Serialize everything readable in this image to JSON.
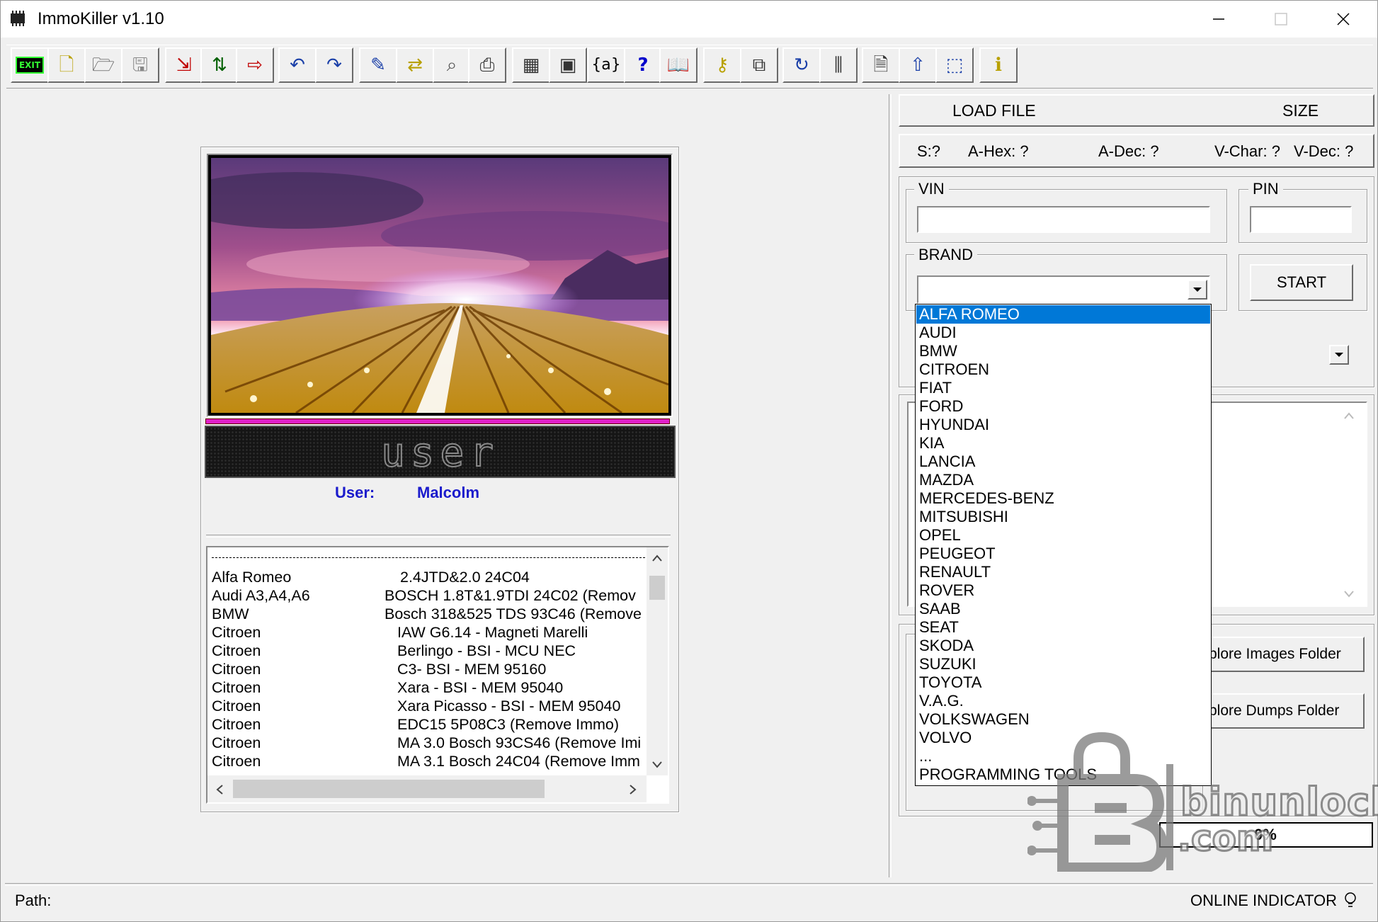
{
  "window": {
    "title": "ImmoKiller v1.10"
  },
  "toolbar": {
    "buttons": [
      {
        "name": "exit-button",
        "glyph": "EXIT",
        "color": "#008000"
      },
      {
        "name": "new-file-button",
        "glyph": "🗋",
        "color": "#b8a000"
      },
      {
        "name": "open-file-button",
        "glyph": "🗁",
        "color": "#444444"
      },
      {
        "name": "save-button",
        "glyph": "🖫",
        "color": "#888888"
      },
      {
        "name": "import-button",
        "glyph": "⇲",
        "color": "#c00000"
      },
      {
        "name": "swap-bytes-button",
        "glyph": "⇅",
        "color": "#006000"
      },
      {
        "name": "export-button",
        "glyph": "⇨",
        "color": "#c00000"
      },
      {
        "name": "undo-button",
        "glyph": "↶",
        "color": "#1a3fa8"
      },
      {
        "name": "redo-button",
        "glyph": "↷",
        "color": "#1a3fa8"
      },
      {
        "name": "edit-button",
        "glyph": "✎",
        "color": "#1a3fa8"
      },
      {
        "name": "convert-button",
        "glyph": "⇄",
        "color": "#b8a000"
      },
      {
        "name": "find-button",
        "glyph": "⌕",
        "color": "#555555"
      },
      {
        "name": "print-button",
        "glyph": "⎙",
        "color": "#333333"
      },
      {
        "name": "calculator-button",
        "glyph": "▦",
        "color": "#333333"
      },
      {
        "name": "chip-button",
        "glyph": "▣",
        "color": "#333333"
      },
      {
        "name": "variables-button",
        "glyph": "{a}",
        "color": "#000000"
      },
      {
        "name": "help-button",
        "glyph": "?",
        "color": "#0000cc"
      },
      {
        "name": "manual-button",
        "glyph": "📖",
        "color": "#444444"
      },
      {
        "name": "key-button",
        "glyph": "⚷",
        "color": "#b8a000"
      },
      {
        "name": "copy-windows-button",
        "glyph": "⧉",
        "color": "#333333"
      },
      {
        "name": "refresh-button",
        "glyph": "↻",
        "color": "#1a3fa8"
      },
      {
        "name": "columns-button",
        "glyph": "⫼",
        "color": "#333333"
      },
      {
        "name": "new-doc-button",
        "glyph": "🗎",
        "color": "#333333"
      },
      {
        "name": "upload-button",
        "glyph": "⇧",
        "color": "#1a3fa8"
      },
      {
        "name": "select-area-button",
        "glyph": "⬚",
        "color": "#1a3fa8"
      },
      {
        "name": "info-button",
        "glyph": "ℹ",
        "color": "#b8a000"
      }
    ]
  },
  "left": {
    "banner_text": "user",
    "user_label": "User:",
    "user_name": "Malcolm",
    "list_rows": [
      {
        "brand": "Alfa Romeo",
        "module": "2.4JTD&2.0     24C04"
      },
      {
        "brand": "Audi A3,A4,A6",
        "module": "BOSCH 1.8T&1.9TDI    24C02 (Remov"
      },
      {
        "brand": "BMW",
        "module": "Bosch 318&525 TDS 93C46 (Remove"
      },
      {
        "brand": "Citroen",
        "module": "IAW G6.14 - Magneti Marelli"
      },
      {
        "brand": "Citroen",
        "module": "Berlingo - BSI - MCU NEC"
      },
      {
        "brand": "Citroen",
        "module": "C3- BSI - MEM 95160"
      },
      {
        "brand": "Citroen",
        "module": "Xara - BSI - MEM 95040"
      },
      {
        "brand": "Citroen",
        "module": "Xara Picasso      - BSI - MEM 95040"
      },
      {
        "brand": "Citroen",
        "module": "EDC15 5P08C3 (Remove Immo)"
      },
      {
        "brand": "Citroen",
        "module": "MA 3.0 Bosch 93CS46 (Remove Imi"
      },
      {
        "brand": "Citroen",
        "module": "MA 3.1 Bosch 24C04 (Remove Imm"
      }
    ]
  },
  "right": {
    "load_file": "LOAD FILE",
    "size": "SIZE",
    "info": {
      "s": "S:?",
      "ahex": "A-Hex: ?",
      "adec": "A-Dec: ?",
      "vchar": "V-Char: ?",
      "vdec": "V-Dec: ?"
    },
    "vin_label": "VIN",
    "pin_label": "PIN",
    "brand_label": "BRAND",
    "start_button": "START",
    "explore_images": "plore Images Folder",
    "explore_dumps": "plore Dumps Folder",
    "progress": "0%",
    "brand_options": [
      "ALFA ROMEO",
      "AUDI",
      "BMW",
      "CITROEN",
      "FIAT",
      "FORD",
      "HYUNDAI",
      "KIA",
      "LANCIA",
      "MAZDA",
      "MERCEDES-BENZ",
      "MITSUBISHI",
      "OPEL",
      "PEUGEOT",
      "RENAULT",
      "ROVER",
      "SAAB",
      "SEAT",
      "SKODA",
      "SUZUKI",
      "TOYOTA",
      "V.A.G.",
      "VOLKSWAGEN",
      "VOLVO",
      "...",
      "PROGRAMMING TOOLS"
    ],
    "selected_brand": "ALFA ROMEO"
  },
  "status": {
    "path_label": "Path:",
    "online_indicator": "ONLINE INDICATOR"
  },
  "watermark": {
    "line1": "binunlock",
    "line2": ".com"
  },
  "colors": {
    "selection": "#0078d7",
    "user_text": "#1b1bcc",
    "magenta_bar": "#e020c8"
  }
}
